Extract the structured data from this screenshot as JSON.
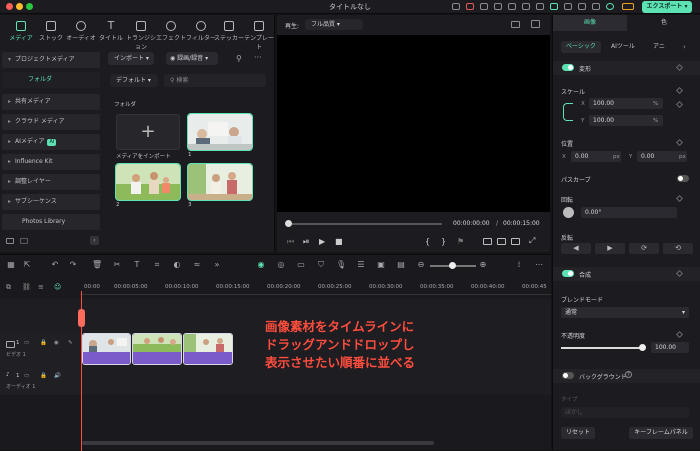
{
  "window": {
    "title": "タイトルなし"
  },
  "export_button": "エクスポート",
  "toolbar": {
    "tabs": [
      "メディア",
      "ストック",
      "オーディオ",
      "タイトル",
      "トランジション",
      "エフェクト",
      "フィルター",
      "ステッカー",
      "テンプレート"
    ]
  },
  "sidebar": {
    "items": [
      {
        "label": "プロジェクトメディア"
      },
      {
        "label": "フォルダ"
      },
      {
        "label": "共有メディア"
      },
      {
        "label": "クラウド メディア"
      },
      {
        "label": "AIメディア",
        "badge": "AI"
      },
      {
        "label": "Influence Kit"
      },
      {
        "label": "調整レイヤー"
      },
      {
        "label": "サブシーケンス"
      },
      {
        "label": "Photos Library"
      }
    ]
  },
  "media": {
    "import_dropdown": "インポート",
    "record_dropdown": "録画/録音",
    "sort_dropdown": "デフォルト",
    "search_placeholder": "検索",
    "folder_label": "フォルダ",
    "import_tile_label": "メディアをインポート",
    "items": [
      {
        "caption": "1"
      },
      {
        "caption": "2"
      },
      {
        "caption": "3"
      }
    ]
  },
  "preview": {
    "label": "再生:",
    "quality": "フル品質",
    "current_time": "00:00:00:00",
    "separator": "/",
    "total_time": "00:00:15:00"
  },
  "timeline": {
    "ruler": [
      "00:00",
      "00:00:05:00",
      "00:00:10:00",
      "00:00:15:00",
      "00:00:20:00",
      "00:00:25:00",
      "00:00:30:00",
      "00:00:35:00",
      "00:00:40:00",
      "00:00:45"
    ],
    "tracks": [
      {
        "name": "ビデオ 1",
        "number": "1"
      },
      {
        "name": "オーディオ 1",
        "number": "1"
      }
    ],
    "overlay_lines": [
      "画像素材をタイムラインに",
      "ドラッグアンドドロップし",
      "表示させたい順番に並べる"
    ]
  },
  "properties": {
    "tabs": [
      "画像",
      "色"
    ],
    "subtabs": [
      "ベーシック",
      "AIツール",
      "アニ"
    ],
    "transform_label": "変形",
    "scale_label": "スケール",
    "scale_x": "100.00",
    "scale_y": "100.00",
    "percent": "%",
    "position_label": "位置",
    "pos_x": "0.00",
    "pos_y": "0.00",
    "px": "px",
    "x": "X",
    "y": "Y",
    "pathcurve_label": "パスカーブ",
    "rotate_label": "回転",
    "rotate_value": "0.00°",
    "flip_label": "反転",
    "composite_label": "合成",
    "blend_mode_label": "ブレンドモード",
    "blend_mode_value": "通常",
    "opacity_label": "不透明度",
    "opacity_value": "100.00",
    "opacity_fraction": 1.0,
    "background_label": "バックグラウンド",
    "type_label": "タイプ",
    "type_value": "ぼかし",
    "reset_button": "リセット",
    "keyframe_button": "キーフレームパネル"
  },
  "colors": {
    "accent": "#5de2b3",
    "playhead": "#ff4d3d",
    "clip_audio": "#7a5bc9",
    "overlay_text": "#ff4d3d"
  }
}
